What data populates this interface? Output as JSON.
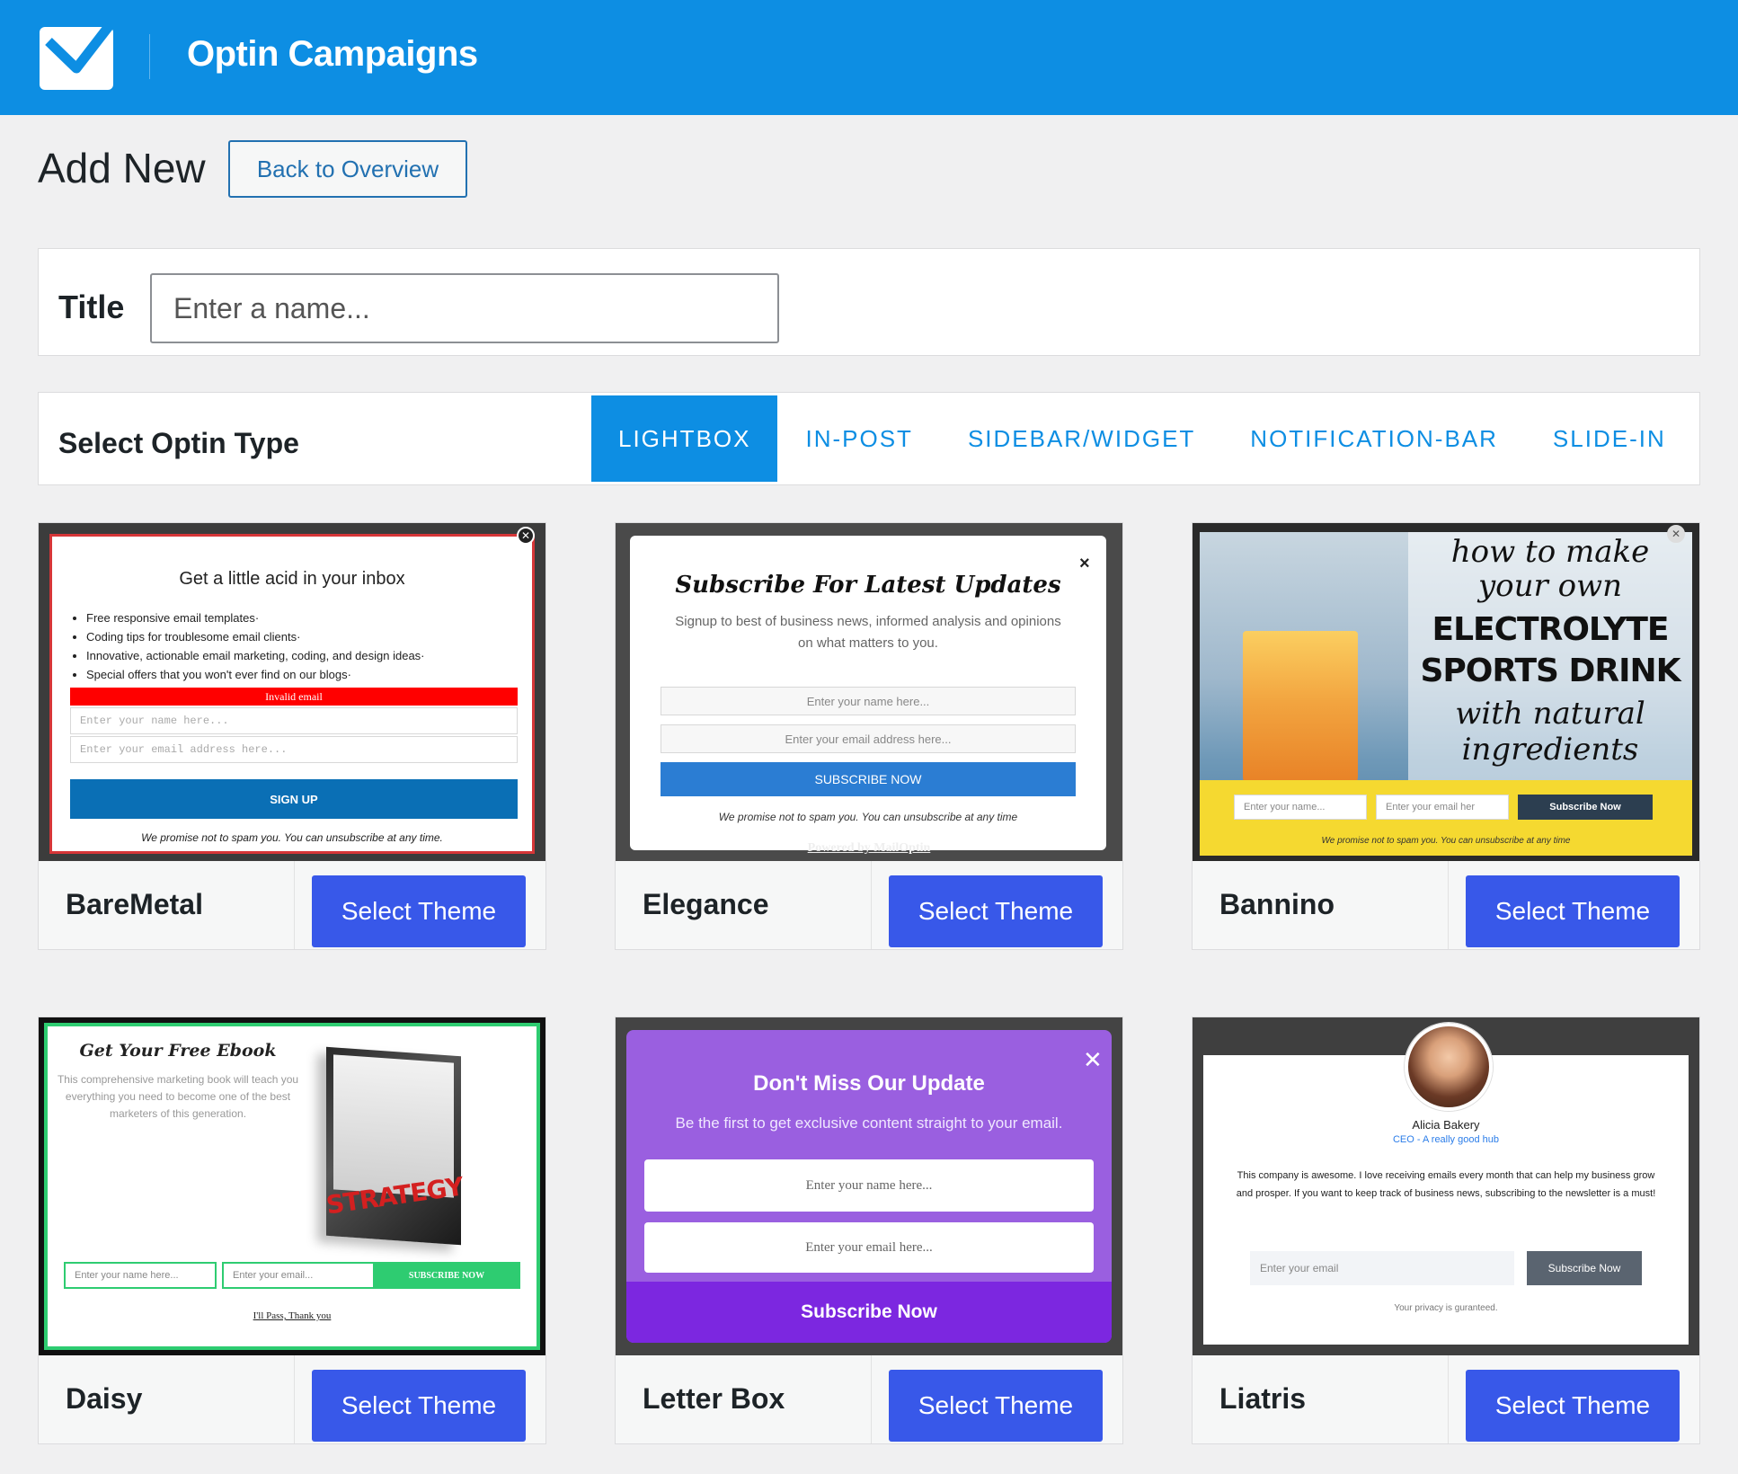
{
  "header": {
    "title": "Optin Campaigns"
  },
  "page": {
    "title": "Add New",
    "back_label": "Back to Overview"
  },
  "title_field": {
    "label": "Title",
    "placeholder": "Enter a name..."
  },
  "optin_type": {
    "label": "Select Optin Type",
    "tabs": [
      "LIGHTBOX",
      "IN-POST",
      "SIDEBAR/WIDGET",
      "NOTIFICATION-BAR",
      "SLIDE-IN"
    ],
    "active": "LIGHTBOX"
  },
  "select_theme_label": "Select Theme",
  "themes": [
    {
      "name": "BareMetal",
      "preview": {
        "title": "Get a little acid in your inbox",
        "bullets": [
          "Free responsive email templates·",
          "Coding tips for troublesome email clients·",
          "Innovative, actionable email marketing, coding, and design ideas·",
          "Special offers that you won't ever find on our blogs·"
        ],
        "error": "Invalid email",
        "name_placeholder": "Enter your name here...",
        "email_placeholder": "Enter your email address here...",
        "button": "SIGN UP",
        "note": "We promise not to spam you. You can unsubscribe at any time."
      }
    },
    {
      "name": "Elegance",
      "preview": {
        "title": "Subscribe For Latest Updates",
        "subtitle": "Signup to best of business news, informed analysis and opinions on what matters to you.",
        "name_placeholder": "Enter your name here...",
        "email_placeholder": "Enter your email address here...",
        "button": "SUBSCRIBE NOW",
        "note": "We promise not to spam you. You can unsubscribe at any time",
        "powered": "Powered by MailOptin"
      }
    },
    {
      "name": "Bannino",
      "preview": {
        "line1": "how to make",
        "line2": "your own",
        "line3": "ELECTROLYTE",
        "line4": "SPORTS DRINK",
        "line5": "with natural",
        "line6": "ingredients",
        "name_placeholder": "Enter your name...",
        "email_placeholder": "Enter your email her",
        "button": "Subscribe Now",
        "note": "We promise not to spam you. You can unsubscribe at any time"
      }
    },
    {
      "name": "Daisy",
      "preview": {
        "title": "Get Your Free Ebook",
        "subtitle": "This comprehensive marketing book will teach you everything you need to become one of the best marketers of this generation.",
        "book_title": "STRATEGY",
        "name_placeholder": "Enter your name here...",
        "email_placeholder": "Enter your email...",
        "button": "SUBSCRIBE NOW",
        "link": "I'll Pass, Thank you"
      }
    },
    {
      "name": "Letter Box",
      "preview": {
        "title": "Don't Miss Our Update",
        "subtitle": "Be the first to get exclusive content straight to your email.",
        "name_placeholder": "Enter your name here...",
        "email_placeholder": "Enter your email here...",
        "button": "Subscribe Now"
      }
    },
    {
      "name": "Liatris",
      "preview": {
        "person": "Alicia Bakery",
        "role": "CEO - A really good hub",
        "text": "This company is awesome. I love receiving emails every month that can help my business grow and prosper. If you want to keep track of business news, subscribing to the newsletter is a must!",
        "email_placeholder": "Enter your email",
        "button": "Subscribe Now",
        "privacy": "Your privacy is guranteed."
      }
    }
  ],
  "colors": {
    "header": "#0d8ee3",
    "select_button": "#3858e9",
    "link": "#2271b1"
  }
}
